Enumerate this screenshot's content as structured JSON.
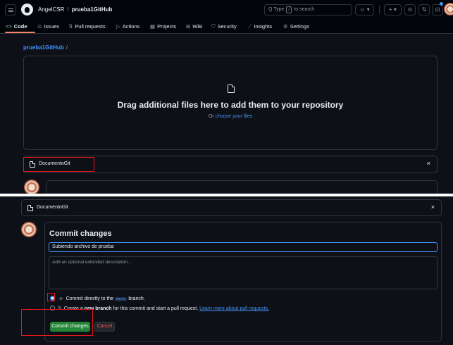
{
  "header": {
    "owner": "AngelCSR",
    "separator": "/",
    "repo": "prueba1GitHub",
    "search_prefix": "Q Type",
    "search_key": "/",
    "search_suffix": "to search"
  },
  "tabs": [
    {
      "label": "Code",
      "icon": "<>"
    },
    {
      "label": "Issues",
      "icon": "⊙"
    },
    {
      "label": "Pull requests",
      "icon": "⇅"
    },
    {
      "label": "Actions",
      "icon": "▷"
    },
    {
      "label": "Projects",
      "icon": "▦"
    },
    {
      "label": "Wiki",
      "icon": "⊞"
    },
    {
      "label": "Security",
      "icon": "⛉"
    },
    {
      "label": "Insights",
      "icon": "⟋"
    },
    {
      "label": "Settings",
      "icon": "⚙"
    }
  ],
  "upload": {
    "repo_link": "prueba1GitHub",
    "slash": "/",
    "drag_title": "Drag additional files here to add them to your repository",
    "or_text": "Or",
    "choose_link": "choose your files",
    "file_name": "DocumentoGit",
    "close": "×"
  },
  "commit": {
    "title": "Commit changes",
    "message": "Subiendo archivo de prueba",
    "description_placeholder": "Add an optional extended description...",
    "direct_prefix": "Commit directly to the",
    "direct_branch": "main",
    "direct_suffix": "branch.",
    "new_branch_prefix": "Create a",
    "new_branch_bold": "new branch",
    "new_branch_suffix": "for this commit and start a pull request.",
    "learn_more": "Learn more about pull requests.",
    "commit_button": "Commit changes",
    "cancel_button": "Cancel"
  },
  "colors": {
    "background": "#0d1117",
    "accent_link": "#4493f8",
    "commit_green": "#238636",
    "cancel_red": "#f85149",
    "highlight_box": "#e5161a"
  }
}
